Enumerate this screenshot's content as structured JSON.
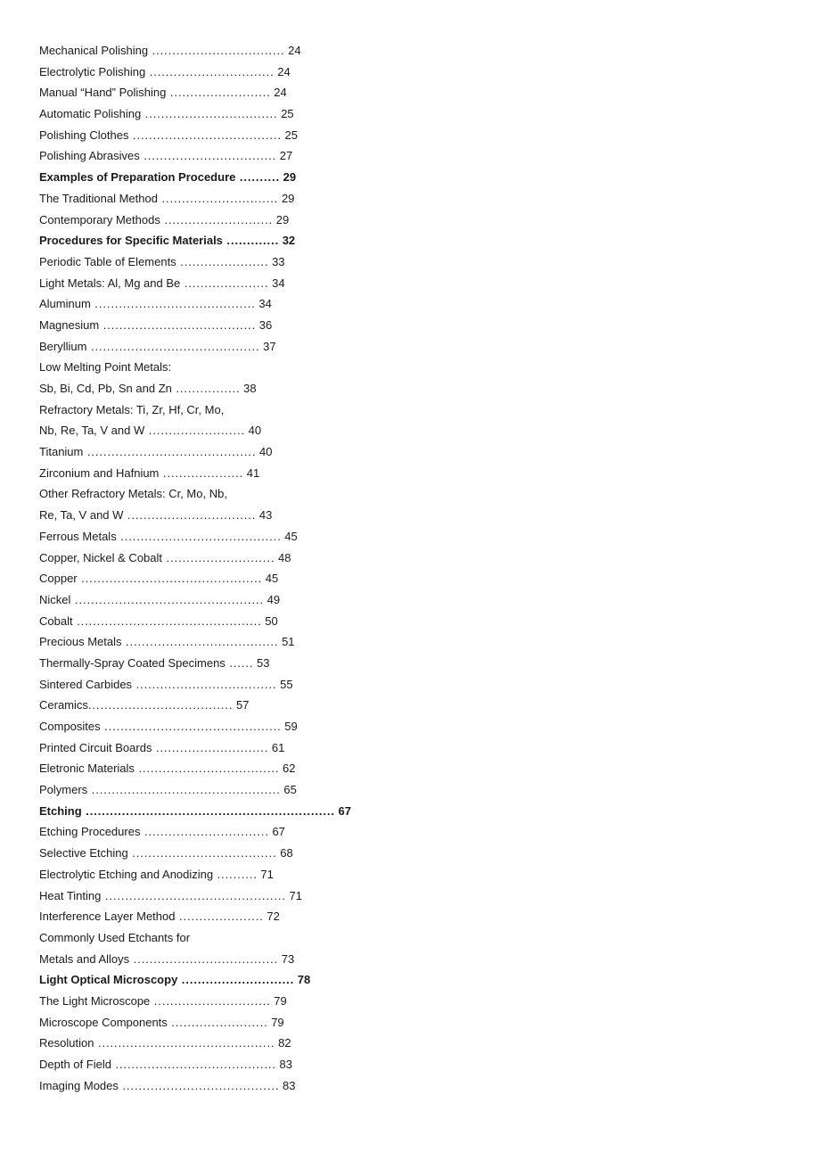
{
  "document": {
    "type": "table-of-contents",
    "page_background": "#ffffff",
    "text_color": "#1a1a1a"
  },
  "toc": {
    "entries": [
      {
        "title": "Mechanical Polishing",
        "leader": " .................................",
        "page": "24",
        "bold": false,
        "continuation": false
      },
      {
        "title": "Electrolytic Polishing",
        "leader": " ...............................",
        "page": "24",
        "bold": false,
        "continuation": false
      },
      {
        "title": "Manual “Hand” Polishing",
        "leader": " .........................",
        "page": "24",
        "bold": false,
        "continuation": false
      },
      {
        "title": "Automatic Polishing",
        "leader": " .................................",
        "page": "25",
        "bold": false,
        "continuation": false
      },
      {
        "title": "Polishing Clothes",
        "leader": " .....................................",
        "page": "25",
        "bold": false,
        "continuation": false
      },
      {
        "title": "Polishing Abrasives",
        "leader": " .................................",
        "page": "27",
        "bold": false,
        "continuation": false
      },
      {
        "title": "Examples of Preparation Procedure",
        "leader": " ..........",
        "page": "29",
        "bold": true,
        "continuation": false
      },
      {
        "title": "The Traditional Method",
        "leader": " .............................",
        "page": "29",
        "bold": false,
        "continuation": false
      },
      {
        "title": "Contemporary Methods",
        "leader": " ...........................",
        "page": "29",
        "bold": false,
        "continuation": false
      },
      {
        "title": "Procedures for Specific Materials",
        "leader": " .............",
        "page": "32",
        "bold": true,
        "continuation": false
      },
      {
        "title": "Periodic Table of Elements",
        "leader": " ......................",
        "page": "33",
        "bold": false,
        "continuation": false
      },
      {
        "title": "Light Metals: Al, Mg and Be",
        "leader": " .....................",
        "page": "34",
        "bold": false,
        "continuation": false
      },
      {
        "title": "Aluminum",
        "leader": " ........................................",
        "page": "34",
        "bold": false,
        "continuation": false
      },
      {
        "title": "Magnesium",
        "leader": " ......................................",
        "page": "36",
        "bold": false,
        "continuation": false
      },
      {
        "title": "Beryllium",
        "leader": " ..........................................",
        "page": "37",
        "bold": false,
        "continuation": false
      },
      {
        "title": "Low Melting Point Metals:",
        "leader": "",
        "page": "",
        "bold": false,
        "continuation": true
      },
      {
        "title": "Sb, Bi, Cd, Pb, Sn and Zn",
        "leader": " ................",
        "page": "38",
        "bold": false,
        "continuation": false
      },
      {
        "title": "Refractory Metals: Ti, Zr, Hf, Cr, Mo,",
        "leader": "",
        "page": "",
        "bold": false,
        "continuation": true
      },
      {
        "title": "Nb, Re, Ta, V and W",
        "leader": " ........................",
        "page": "40",
        "bold": false,
        "continuation": false
      },
      {
        "title": "Titanium",
        "leader": " ..........................................",
        "page": "40",
        "bold": false,
        "continuation": false
      },
      {
        "title": "Zirconium and Hafnium",
        "leader": " ....................",
        "page": "41",
        "bold": false,
        "continuation": false
      },
      {
        "title": "Other Refractory Metals: Cr, Mo, Nb,",
        "leader": "",
        "page": "",
        "bold": false,
        "continuation": true
      },
      {
        "title": "Re, Ta, V and W",
        "leader": " ................................",
        "page": "43",
        "bold": false,
        "continuation": false
      },
      {
        "title": "Ferrous Metals",
        "leader": " ........................................",
        "page": "45",
        "bold": false,
        "continuation": false
      },
      {
        "title": "Copper, Nickel & Cobalt",
        "leader": " ...........................",
        "page": "48",
        "bold": false,
        "continuation": false
      },
      {
        "title": "Copper",
        "leader": " .............................................",
        "page": "45",
        "bold": false,
        "continuation": false
      },
      {
        "title": "Nickel",
        "leader": " ...............................................",
        "page": "49",
        "bold": false,
        "continuation": false
      },
      {
        "title": "Cobalt",
        "leader": " ..............................................",
        "page": "50",
        "bold": false,
        "continuation": false
      },
      {
        "title": "Precious Metals",
        "leader": " ......................................",
        "page": "51",
        "bold": false,
        "continuation": false
      },
      {
        "title": "Thermally-Spray Coated Specimens",
        "leader": " ......",
        "page": "53",
        "bold": false,
        "continuation": false
      },
      {
        "title": "Sintered Carbides",
        "leader": " ...................................",
        "page": "55",
        "bold": false,
        "continuation": false
      },
      {
        "title": "Ceramics",
        "leader": "....................................",
        "page": "57",
        "bold": false,
        "continuation": false
      },
      {
        "title": "Composites",
        "leader": " ............................................",
        "page": "59",
        "bold": false,
        "continuation": false
      },
      {
        "title": "Printed Circuit Boards",
        "leader": " ............................",
        "page": "61",
        "bold": false,
        "continuation": false
      },
      {
        "title": "Eletronic Materials",
        "leader": " ...................................",
        "page": "62",
        "bold": false,
        "continuation": false
      },
      {
        "title": "Polymers",
        "leader": " ...............................................",
        "page": "65",
        "bold": false,
        "continuation": false
      },
      {
        "title": "Etching",
        "leader": " ..............................................................",
        "page": "67",
        "bold": true,
        "continuation": false
      },
      {
        "title": "Etching Procedures",
        "leader": " ...............................",
        "page": "67",
        "bold": false,
        "continuation": false
      },
      {
        "title": "Selective Etching",
        "leader": " ....................................",
        "page": "68",
        "bold": false,
        "continuation": false
      },
      {
        "title": "Electrolytic Etching and Anodizing",
        "leader": " ..........",
        "page": "71",
        "bold": false,
        "continuation": false
      },
      {
        "title": "Heat Tinting",
        "leader": " .............................................",
        "page": "71",
        "bold": false,
        "continuation": false
      },
      {
        "title": "Interference Layer Method",
        "leader": " .....................",
        "page": "72",
        "bold": false,
        "continuation": false
      },
      {
        "title": "Commonly Used Etchants for",
        "leader": "",
        "page": "",
        "bold": false,
        "continuation": true
      },
      {
        "title": "Metals and Alloys",
        "leader": " ....................................",
        "page": "73",
        "bold": false,
        "continuation": false
      },
      {
        "title": "Light Optical Microscopy",
        "leader": " ............................",
        "page": "78",
        "bold": true,
        "continuation": false
      },
      {
        "title": "The Light Microscope",
        "leader": " .............................",
        "page": "79",
        "bold": false,
        "continuation": false
      },
      {
        "title": "Microscope Components",
        "leader": " ........................",
        "page": "79",
        "bold": false,
        "continuation": false
      },
      {
        "title": "Resolution",
        "leader": " ............................................",
        "page": "82",
        "bold": false,
        "continuation": false
      },
      {
        "title": "Depth of Field",
        "leader": " ........................................",
        "page": "83",
        "bold": false,
        "continuation": false
      },
      {
        "title": "Imaging Modes",
        "leader": " .......................................",
        "page": "83",
        "bold": false,
        "continuation": false
      }
    ]
  }
}
